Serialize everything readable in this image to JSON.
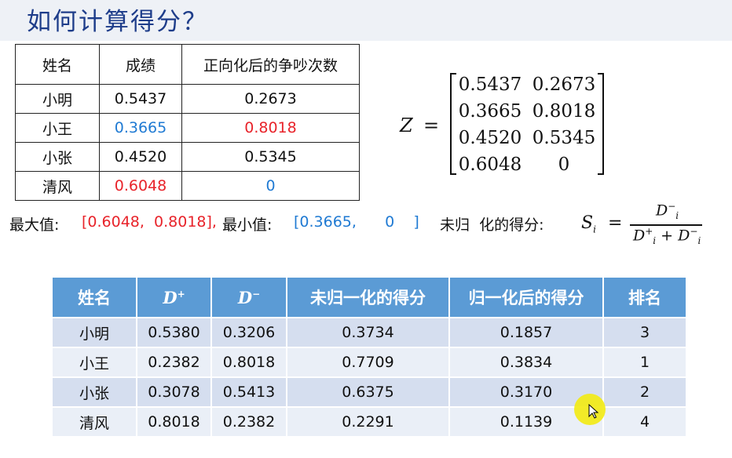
{
  "title": "如何计算得分？",
  "table1": {
    "headers": [
      "姓名",
      "成绩",
      "正向化后的争吵次数"
    ],
    "rows": [
      {
        "name": "小明",
        "score": "0.5437",
        "fights": "0.2673"
      },
      {
        "name": "小王",
        "score": "0.3665",
        "fights": "0.8018"
      },
      {
        "name": "小张",
        "score": "0.4520",
        "fights": "0.5345"
      },
      {
        "name": "清风",
        "score": "0.6048",
        "fights": "0"
      }
    ]
  },
  "matrix": {
    "label": "Z",
    "equals": "=",
    "rows": [
      [
        "0.5437",
        "0.2673"
      ],
      [
        "0.3665",
        "0.8018"
      ],
      [
        "0.4520",
        "0.5345"
      ],
      [
        "0.6048",
        "0"
      ]
    ]
  },
  "stats": {
    "max_label": "最大值:",
    "max_value": "[0.6048,  0.8018],",
    "min_label": "最小值:",
    "min_value": "[0.3665,      0    ]",
    "unnorm_label": "未归  化的得分:"
  },
  "formula": {
    "lhs": "S",
    "lhs_sub": "i",
    "equals": "=",
    "num": "D",
    "den_a": "D",
    "plus": " + ",
    "den_b": "D",
    "sub": "i",
    "minus": "−",
    "plus_sup": "+"
  },
  "table2": {
    "headers": {
      "name": "姓名",
      "d_plus": "D",
      "d_minus": "D",
      "unnorm": "未归一化的得分",
      "norm": "归一化后的得分",
      "rank": "排名"
    },
    "sup_plus": "+",
    "sup_minus": "−",
    "rows": [
      {
        "name": "小明",
        "dp": "0.5380",
        "dm": "0.3206",
        "un": "0.3734",
        "n": "0.1857",
        "rank": "3"
      },
      {
        "name": "小王",
        "dp": "0.2382",
        "dm": "0.8018",
        "un": "0.7709",
        "n": "0.3834",
        "rank": "1"
      },
      {
        "name": "小张",
        "dp": "0.3078",
        "dm": "0.5413",
        "un": "0.6375",
        "n": "0.3170",
        "rank": "2"
      },
      {
        "name": "清风",
        "dp": "0.8018",
        "dm": "0.2382",
        "un": "0.2291",
        "n": "0.1139",
        "rank": "4"
      }
    ]
  },
  "colors": {
    "red": "#e8232a",
    "blue": "#1f7ad3",
    "header": "#5b9bd5",
    "title": "#1e3d8a"
  }
}
